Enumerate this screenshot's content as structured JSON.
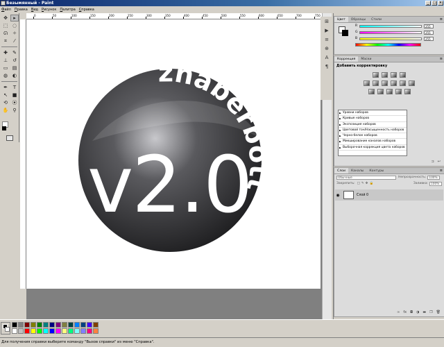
{
  "window": {
    "title": "Безымянный - Paint"
  },
  "menu": [
    "Файл",
    "Правка",
    "Вид",
    "Рисунок",
    "Палитра",
    "Справка"
  ],
  "ruler": {
    "ticks": [
      "0",
      "50",
      "100",
      "150",
      "200",
      "250",
      "300",
      "350",
      "400",
      "450",
      "500",
      "550",
      "600",
      "650",
      "700",
      "750"
    ]
  },
  "logo": {
    "arc_text": "zhaberbottle",
    "version": "v2.0",
    "colors": {
      "dark": "#1f1f21",
      "mid": "#5a5a5e",
      "highlight": "#c8c8cc",
      "text": "#ffffff"
    }
  },
  "color_panel": {
    "tabs": [
      "Цвет",
      "Образцы",
      "Стили"
    ],
    "channels": [
      {
        "label": "R",
        "value": "255"
      },
      {
        "label": "G",
        "value": "255"
      },
      {
        "label": "B",
        "value": "255"
      }
    ]
  },
  "adjust_panel": {
    "tabs": [
      "Коррекция",
      "Маски"
    ],
    "title": "Добавить корректировку",
    "presets": [
      "Уровни наборов",
      "Кривые наборов",
      "Экспозиция наборов",
      "Цветовой тон/Насыщенность наборов",
      "Черно-белое наборов",
      "Микширование каналов наборов",
      "Выборочная коррекция цвета наборов"
    ]
  },
  "layers_panel": {
    "tabs": [
      "Слои",
      "Каналы",
      "Контуры"
    ],
    "blend_mode": "Обычные",
    "opacity_label": "Непрозрачность:",
    "opacity_value": "100%",
    "lock_label": "Закрепить:",
    "fill_label": "Заливка:",
    "fill_value": "100%",
    "layer_name": "Слой 0",
    "footer_icons": [
      "link-icon",
      "fx-icon",
      "mask-icon",
      "adjust-icon",
      "folder-icon",
      "new-layer-icon",
      "trash-icon"
    ]
  },
  "palette_colors": [
    "#000000",
    "#808080",
    "#800000",
    "#808000",
    "#008000",
    "#008080",
    "#000080",
    "#800080",
    "#808040",
    "#004040",
    "#0080ff",
    "#004080",
    "#4000ff",
    "#804000",
    "#ffffff",
    "#c0c0c0",
    "#ff0000",
    "#ffff00",
    "#00ff00",
    "#00ffff",
    "#0000ff",
    "#ff00ff",
    "#ffff80",
    "#00ff80",
    "#80ffff",
    "#8080ff",
    "#ff0080",
    "#ff8040"
  ],
  "status": {
    "text": "Для получения справки выберите команду \"Вызов справки\" из меню \"Справка\"."
  }
}
